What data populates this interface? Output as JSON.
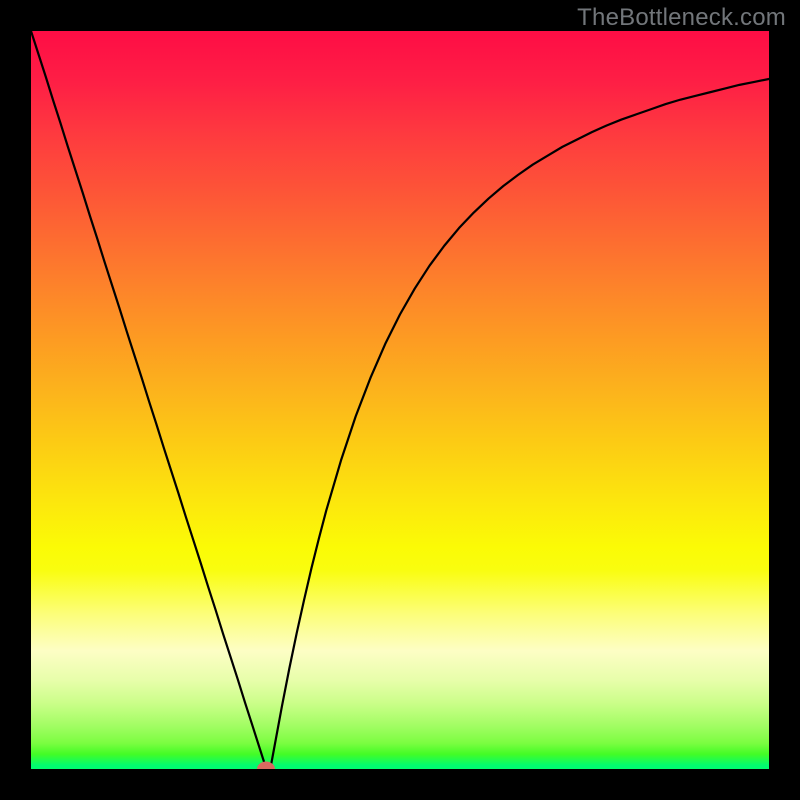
{
  "watermark": "TheBottleneck.com",
  "chart_data": {
    "type": "line",
    "title": "",
    "xlabel": "",
    "ylabel": "",
    "xlim": [
      0,
      1
    ],
    "ylim": [
      0,
      1
    ],
    "grid": false,
    "series": [
      {
        "name": "curve",
        "x": [
          0.0,
          0.01,
          0.02,
          0.03,
          0.04,
          0.05,
          0.06,
          0.07,
          0.08,
          0.09,
          0.1,
          0.11,
          0.12,
          0.13,
          0.14,
          0.15,
          0.16,
          0.17,
          0.18,
          0.19,
          0.2,
          0.21,
          0.22,
          0.23,
          0.24,
          0.25,
          0.26,
          0.27,
          0.28,
          0.29,
          0.3,
          0.315,
          0.318,
          0.32,
          0.325,
          0.33,
          0.34,
          0.35,
          0.36,
          0.37,
          0.38,
          0.39,
          0.4,
          0.42,
          0.44,
          0.46,
          0.48,
          0.5,
          0.52,
          0.54,
          0.56,
          0.58,
          0.6,
          0.62,
          0.64,
          0.66,
          0.68,
          0.7,
          0.72,
          0.74,
          0.76,
          0.78,
          0.8,
          0.82,
          0.84,
          0.86,
          0.88,
          0.9,
          0.92,
          0.94,
          0.96,
          0.98,
          1.0
        ],
        "y": [
          1.0,
          0.969,
          0.938,
          0.906,
          0.875,
          0.843,
          0.812,
          0.781,
          0.749,
          0.718,
          0.686,
          0.655,
          0.624,
          0.592,
          0.561,
          0.53,
          0.498,
          0.467,
          0.435,
          0.404,
          0.373,
          0.341,
          0.31,
          0.279,
          0.247,
          0.216,
          0.184,
          0.153,
          0.122,
          0.09,
          0.059,
          0.012,
          0.003,
          0.0,
          0.004,
          0.031,
          0.085,
          0.136,
          0.184,
          0.229,
          0.272,
          0.312,
          0.35,
          0.418,
          0.478,
          0.53,
          0.576,
          0.616,
          0.651,
          0.682,
          0.709,
          0.733,
          0.754,
          0.773,
          0.79,
          0.805,
          0.819,
          0.831,
          0.843,
          0.853,
          0.863,
          0.872,
          0.88,
          0.887,
          0.894,
          0.901,
          0.907,
          0.912,
          0.917,
          0.922,
          0.927,
          0.931,
          0.935
        ]
      }
    ],
    "marker": {
      "x": 0.318,
      "y": 0.0,
      "color": "#d96a60"
    },
    "colors": {
      "curve": "#000000",
      "background_top": "#fe0d45",
      "background_bottom": "#01fb6f"
    }
  }
}
